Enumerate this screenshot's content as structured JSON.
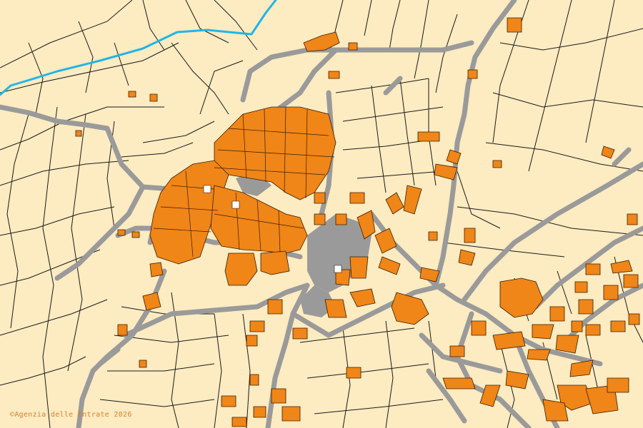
{
  "map": {
    "type": "cadastral",
    "colors": {
      "background": "#fdebc1",
      "parcel_line": "#1a1a1a",
      "building": "#f08518",
      "building_edge": "#3a1e00",
      "road": "#9a9a9a",
      "river": "#1fb6e8"
    }
  },
  "attribution": {
    "text": "©Agenzia delle Entrate 2026"
  }
}
